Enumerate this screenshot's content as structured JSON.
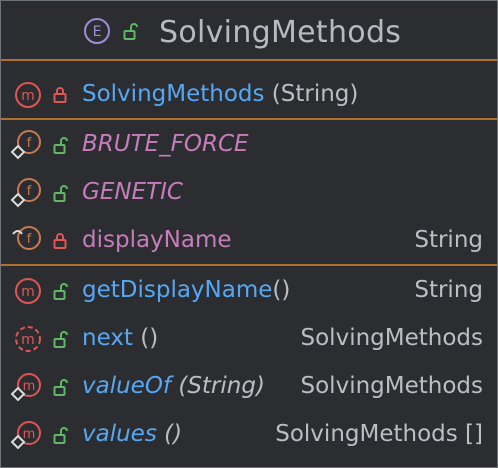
{
  "class": {
    "kind_letter": "E",
    "name": "SolvingMethods"
  },
  "constructors": [
    {
      "name": "SolvingMethods",
      "params": " (String)",
      "visibility": "private",
      "icon": "method-icon",
      "lock_icon": "private-lock-icon"
    }
  ],
  "fields": [
    {
      "name": "BRUTE_FORCE",
      "type": "",
      "visibility": "public",
      "icon": "static-field-icon",
      "lock_icon": "public-unlock-icon"
    },
    {
      "name": "GENETIC",
      "type": "",
      "visibility": "public",
      "icon": "static-field-icon",
      "lock_icon": "public-unlock-icon"
    },
    {
      "name": "displayName",
      "type": "String",
      "visibility": "private",
      "icon": "field-icon",
      "lock_icon": "private-lock-icon"
    }
  ],
  "methods": [
    {
      "name": "getDisplayName",
      "params": "()",
      "type": "String",
      "visibility": "public",
      "icon": "method-icon"
    },
    {
      "name": "next",
      "params": " ()",
      "type": "SolvingMethods",
      "visibility": "public",
      "icon": "abstract-method-icon"
    },
    {
      "name": "valueOf",
      "params": " (String)",
      "type": "SolvingMethods",
      "visibility": "public",
      "icon": "static-method-icon"
    },
    {
      "name": "values",
      "params": " ()",
      "type": "SolvingMethods []",
      "visibility": "public",
      "icon": "static-method-icon"
    }
  ],
  "colors": {
    "background": "#2b2d30",
    "border": "#6f737a",
    "separator": "#b0702a",
    "method_name": "#56a8f5",
    "field_name": "#c77dbb",
    "text": "#bcbec4",
    "enum_badge": "#a28cd9",
    "method_badge": "#e05555",
    "field_badge": "#c87a50",
    "public_lock": "#5fb865",
    "private_lock": "#e05555"
  }
}
